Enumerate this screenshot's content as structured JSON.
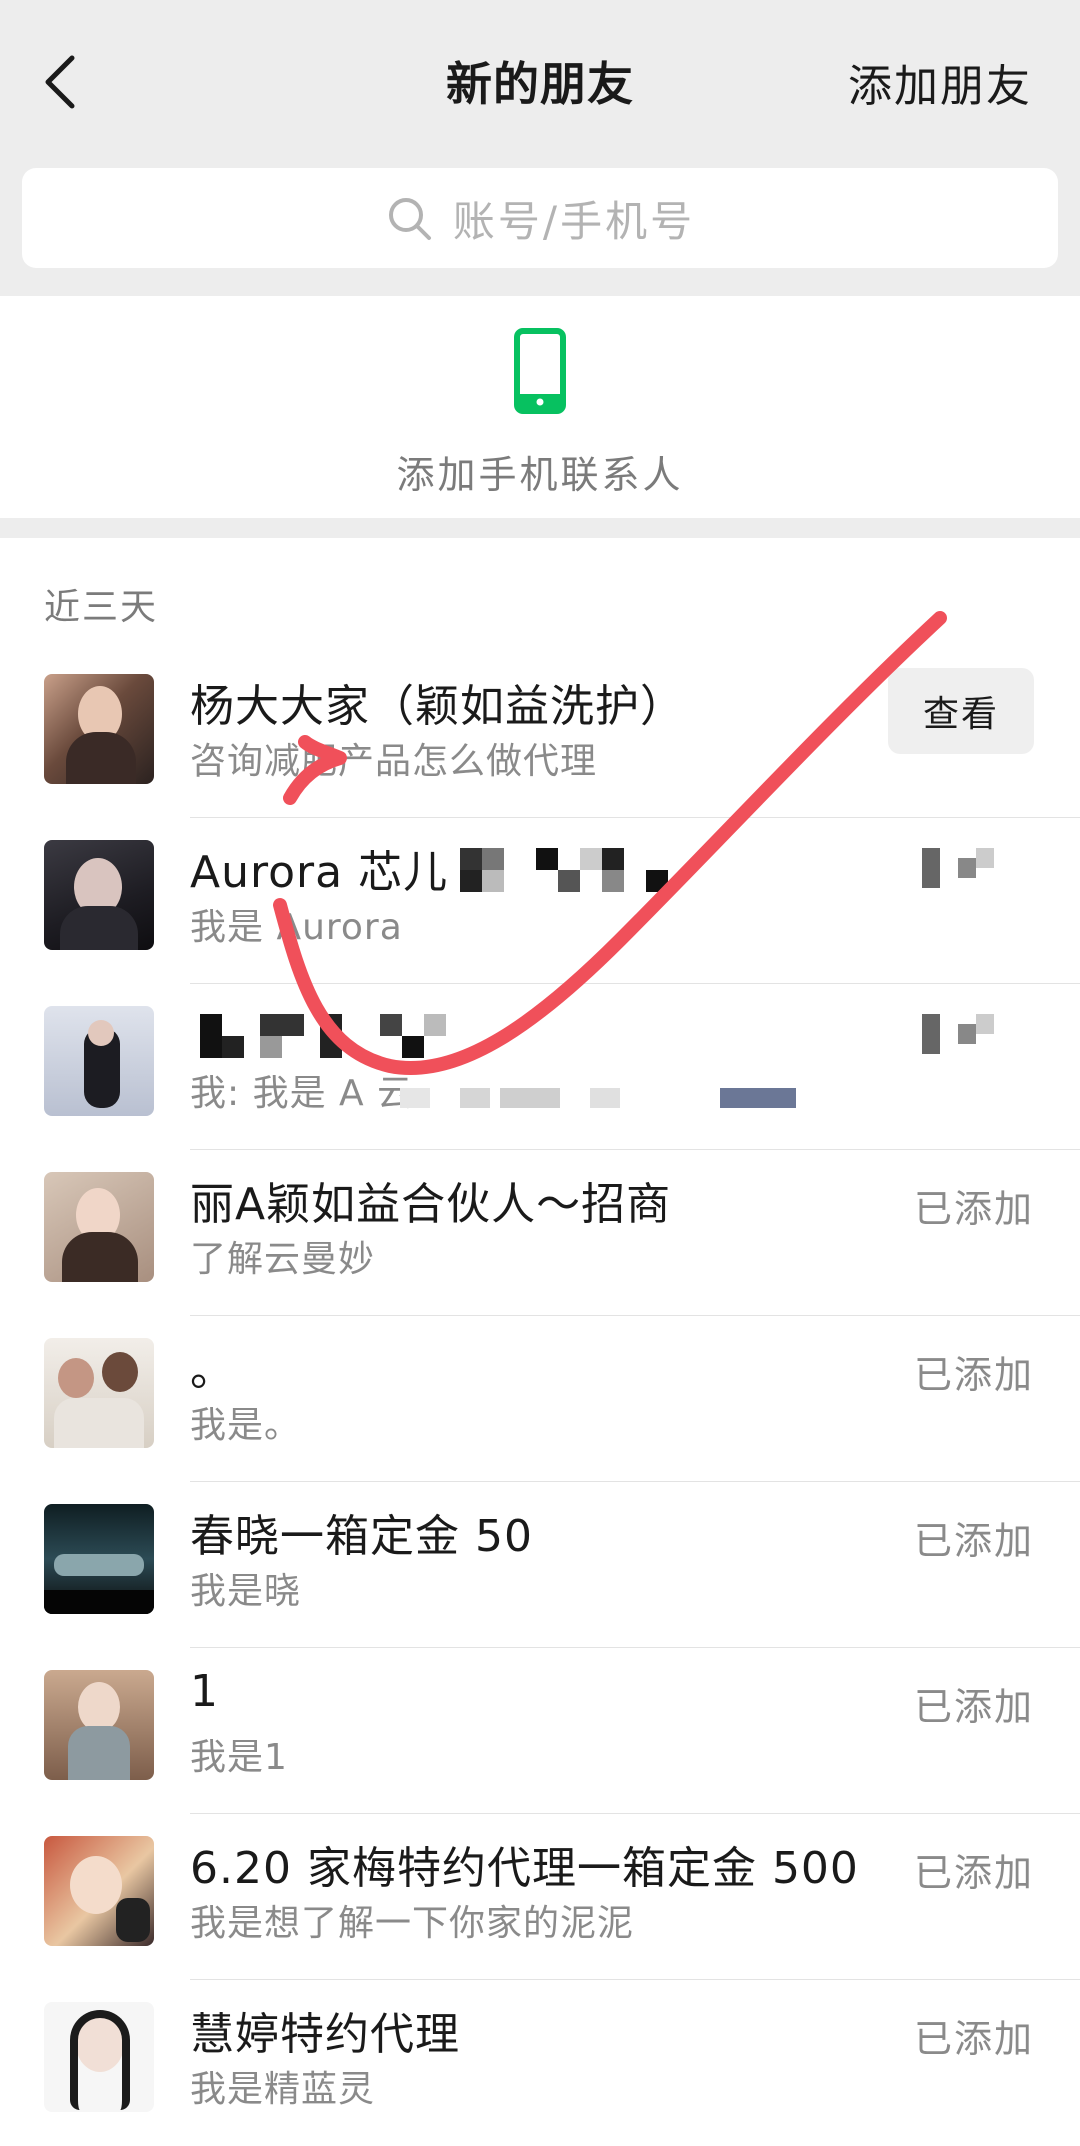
{
  "header": {
    "title": "新的朋友",
    "add_friend_label": "添加朋友",
    "back_icon": "chevron-left-icon"
  },
  "search": {
    "placeholder": "账号/手机号",
    "icon": "search-icon"
  },
  "phone_contacts": {
    "label": "添加手机联系人",
    "icon": "phone-icon",
    "icon_color": "#07c160"
  },
  "section": {
    "label": "近三天"
  },
  "friends": [
    {
      "name": "杨大大家（颖如益洗护）",
      "message": "咨询减肥产品怎么做代理",
      "action": "查看"
    },
    {
      "name": "Aurora 芯儿",
      "message": "我是 Aurora",
      "status": ""
    },
    {
      "name": "",
      "message": "我: 我是 A 云",
      "status": ""
    },
    {
      "name": "丽A颖如益合伙人～招商",
      "message": "了解云曼妙",
      "status": "已添加"
    },
    {
      "name": "。",
      "message": "我是。",
      "status": "已添加"
    },
    {
      "name": "春晓一箱定金 50",
      "message": "我是晓",
      "status": "已添加"
    },
    {
      "name": "1",
      "message": "我是1",
      "status": "已添加"
    },
    {
      "name": "6.20 家梅特约代理一箱定金 500",
      "message": "我是想了解一下你家的泥泥",
      "status": "已添加"
    },
    {
      "name": "慧婷特约代理",
      "message": "我是精蓝灵",
      "status": "已添加"
    }
  ],
  "colors": {
    "accent_green": "#07c160",
    "annotation_red": "#f0505a",
    "background_gray": "#ededed"
  }
}
